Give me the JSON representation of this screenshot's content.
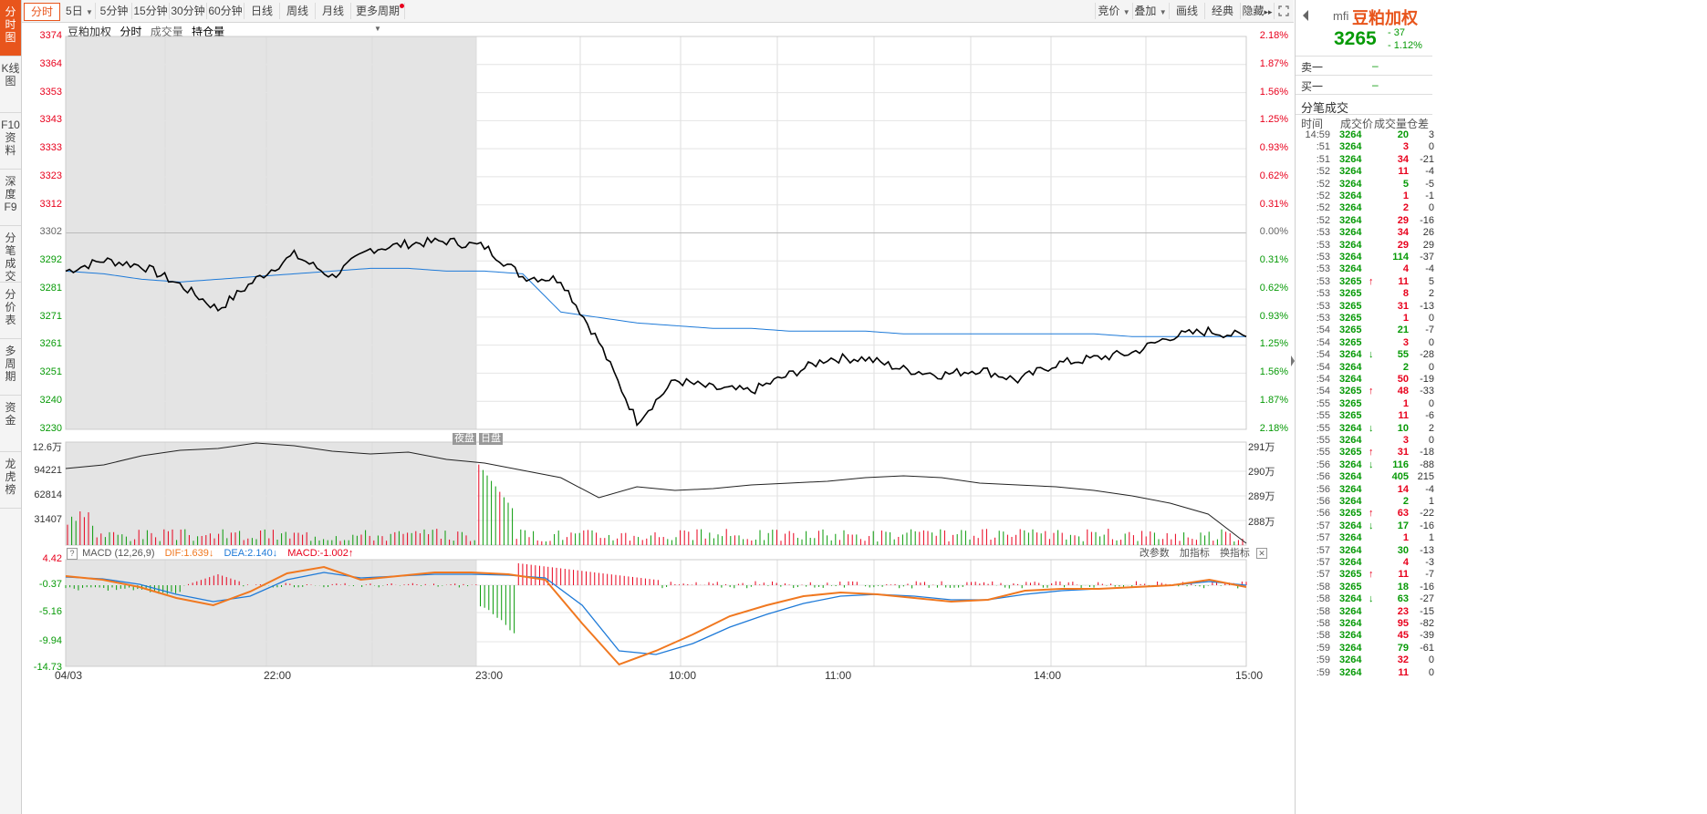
{
  "left_tabs": [
    "分时图",
    "K线图",
    "F10资料",
    "深度F9",
    "分笔成交",
    "分价表",
    "多周期",
    "资金",
    "龙虎榜"
  ],
  "toolbar": {
    "periods": [
      "分时",
      "5日",
      "5分钟",
      "15分钟",
      "30分钟",
      "60分钟",
      "日线",
      "周线",
      "月线",
      "更多周期"
    ],
    "right": [
      "竞价",
      "叠加",
      "画线",
      "经典",
      "隐藏"
    ]
  },
  "legend": {
    "name": "豆粕加权",
    "mode": "分时",
    "vol": "成交量",
    "oi": "持仓量"
  },
  "price_axis": {
    "left": [
      "3374",
      "3364",
      "3353",
      "3343",
      "3333",
      "3323",
      "3312",
      "3302",
      "3292",
      "3281",
      "3271",
      "3261",
      "3251",
      "3240",
      "3230"
    ],
    "right": [
      "2.18%",
      "1.87%",
      "1.56%",
      "1.25%",
      "0.93%",
      "0.62%",
      "0.31%",
      "0.00%",
      "0.31%",
      "0.62%",
      "0.93%",
      "1.25%",
      "1.56%",
      "1.87%",
      "2.18%"
    ]
  },
  "session_tags": {
    "night": "夜盘",
    "day": "日盘"
  },
  "volume_axis": {
    "left": [
      "12.6万",
      "94221",
      "62814",
      "31407"
    ],
    "right": [
      "291万",
      "290万",
      "289万",
      "288万"
    ]
  },
  "macd": {
    "title": "MACD (12,26,9)",
    "dif": "DIF:1.639↓",
    "dea": "DEA:2.140↓",
    "macd": "MACD:-1.002↑",
    "help": "?",
    "links": [
      "改参数",
      "加指标",
      "换指标"
    ],
    "axis": [
      "4.42",
      "-0.37",
      "-5.16",
      "-9.94",
      "-14.73"
    ]
  },
  "time_axis": [
    "04/03",
    "22:00",
    "23:00",
    "10:00",
    "11:00",
    "14:00",
    "15:00"
  ],
  "colors": {
    "up": "#e8001c",
    "down": "#079a07",
    "accent": "#e8551c",
    "avg": "#1e7ad8",
    "dif": "#f07820",
    "dea": "#1e7ad8"
  },
  "quote": {
    "code": "mfi",
    "name": "豆粕加权",
    "price": "3265",
    "change": "- 37",
    "pct": "- 1.12%"
  },
  "orderbook": {
    "sell_label": "卖一",
    "sell_val": "–",
    "buy_label": "买一",
    "buy_val": "–"
  },
  "ticks_title": "分笔成交",
  "ticks_header": [
    "时间",
    "成交价",
    "成交量",
    "仓差"
  ],
  "ticks": [
    {
      "t": "14:59",
      "p": "3264",
      "a": "",
      "v": "20",
      "d": "3",
      "c": "g"
    },
    {
      "t": ":51",
      "p": "3264",
      "a": "",
      "v": "3",
      "d": "0",
      "c": "r"
    },
    {
      "t": ":51",
      "p": "3264",
      "a": "",
      "v": "34",
      "d": "-21",
      "c": "r"
    },
    {
      "t": ":52",
      "p": "3264",
      "a": "",
      "v": "11",
      "d": "-4",
      "c": "r"
    },
    {
      "t": ":52",
      "p": "3264",
      "a": "",
      "v": "5",
      "d": "-5",
      "c": "g"
    },
    {
      "t": ":52",
      "p": "3264",
      "a": "",
      "v": "1",
      "d": "-1",
      "c": "r"
    },
    {
      "t": ":52",
      "p": "3264",
      "a": "",
      "v": "2",
      "d": "0",
      "c": "r"
    },
    {
      "t": ":52",
      "p": "3264",
      "a": "",
      "v": "29",
      "d": "-16",
      "c": "r"
    },
    {
      "t": ":53",
      "p": "3264",
      "a": "",
      "v": "34",
      "d": "26",
      "c": "r"
    },
    {
      "t": ":53",
      "p": "3264",
      "a": "",
      "v": "29",
      "d": "29",
      "c": "r"
    },
    {
      "t": ":53",
      "p": "3264",
      "a": "",
      "v": "114",
      "d": "-37",
      "c": "g"
    },
    {
      "t": ":53",
      "p": "3264",
      "a": "",
      "v": "4",
      "d": "-4",
      "c": "r"
    },
    {
      "t": ":53",
      "p": "3265",
      "a": "↑",
      "v": "11",
      "d": "5",
      "c": "r"
    },
    {
      "t": ":53",
      "p": "3265",
      "a": "",
      "v": "8",
      "d": "2",
      "c": "r"
    },
    {
      "t": ":53",
      "p": "3265",
      "a": "",
      "v": "31",
      "d": "-13",
      "c": "r"
    },
    {
      "t": ":53",
      "p": "3265",
      "a": "",
      "v": "1",
      "d": "0",
      "c": "r"
    },
    {
      "t": ":54",
      "p": "3265",
      "a": "",
      "v": "21",
      "d": "-7",
      "c": "g"
    },
    {
      "t": ":54",
      "p": "3265",
      "a": "",
      "v": "3",
      "d": "0",
      "c": "r"
    },
    {
      "t": ":54",
      "p": "3264",
      "a": "↓",
      "v": "55",
      "d": "-28",
      "c": "g"
    },
    {
      "t": ":54",
      "p": "3264",
      "a": "",
      "v": "2",
      "d": "0",
      "c": "g"
    },
    {
      "t": ":54",
      "p": "3264",
      "a": "",
      "v": "50",
      "d": "-19",
      "c": "r"
    },
    {
      "t": ":54",
      "p": "3265",
      "a": "↑",
      "v": "48",
      "d": "-33",
      "c": "r"
    },
    {
      "t": ":55",
      "p": "3265",
      "a": "",
      "v": "1",
      "d": "0",
      "c": "r"
    },
    {
      "t": ":55",
      "p": "3265",
      "a": "",
      "v": "11",
      "d": "-6",
      "c": "r"
    },
    {
      "t": ":55",
      "p": "3264",
      "a": "↓",
      "v": "10",
      "d": "2",
      "c": "g"
    },
    {
      "t": ":55",
      "p": "3264",
      "a": "",
      "v": "3",
      "d": "0",
      "c": "r"
    },
    {
      "t": ":55",
      "p": "3265",
      "a": "↑",
      "v": "31",
      "d": "-18",
      "c": "r"
    },
    {
      "t": ":56",
      "p": "3264",
      "a": "↓",
      "v": "116",
      "d": "-88",
      "c": "g"
    },
    {
      "t": ":56",
      "p": "3264",
      "a": "",
      "v": "405",
      "d": "215",
      "c": "g"
    },
    {
      "t": ":56",
      "p": "3264",
      "a": "",
      "v": "14",
      "d": "-4",
      "c": "r"
    },
    {
      "t": ":56",
      "p": "3264",
      "a": "",
      "v": "2",
      "d": "1",
      "c": "g"
    },
    {
      "t": ":56",
      "p": "3265",
      "a": "↑",
      "v": "63",
      "d": "-22",
      "c": "r"
    },
    {
      "t": ":57",
      "p": "3264",
      "a": "↓",
      "v": "17",
      "d": "-16",
      "c": "g"
    },
    {
      "t": ":57",
      "p": "3264",
      "a": "",
      "v": "1",
      "d": "1",
      "c": "r"
    },
    {
      "t": ":57",
      "p": "3264",
      "a": "",
      "v": "30",
      "d": "-13",
      "c": "g"
    },
    {
      "t": ":57",
      "p": "3264",
      "a": "",
      "v": "4",
      "d": "-3",
      "c": "r"
    },
    {
      "t": ":57",
      "p": "3265",
      "a": "↑",
      "v": "11",
      "d": "-7",
      "c": "r"
    },
    {
      "t": ":58",
      "p": "3265",
      "a": "",
      "v": "18",
      "d": "-16",
      "c": "g"
    },
    {
      "t": ":58",
      "p": "3264",
      "a": "↓",
      "v": "63",
      "d": "-27",
      "c": "g"
    },
    {
      "t": ":58",
      "p": "3264",
      "a": "",
      "v": "23",
      "d": "-15",
      "c": "r"
    },
    {
      "t": ":58",
      "p": "3264",
      "a": "",
      "v": "95",
      "d": "-82",
      "c": "r"
    },
    {
      "t": ":58",
      "p": "3264",
      "a": "",
      "v": "45",
      "d": "-39",
      "c": "r"
    },
    {
      "t": ":59",
      "p": "3264",
      "a": "",
      "v": "79",
      "d": "-61",
      "c": "g"
    },
    {
      "t": ":59",
      "p": "3264",
      "a": "",
      "v": "32",
      "d": "0",
      "c": "r"
    },
    {
      "t": ":59",
      "p": "3264",
      "a": "",
      "v": "11",
      "d": "0",
      "c": "r"
    }
  ],
  "chart_data": {
    "type": "line",
    "title": "豆粕加权 分时",
    "prev_close": 3302,
    "ylim": [
      3230,
      3374
    ],
    "x_ticks": [
      "04/03",
      "22:00",
      "23:00",
      "10:00",
      "11:00",
      "14:00",
      "15:00"
    ],
    "series": [
      {
        "name": "价格",
        "values": [
          3288,
          3292,
          3290,
          3283,
          3274,
          3285,
          3294,
          3286,
          3296,
          3298,
          3299,
          3297,
          3286,
          3285,
          3262,
          3233,
          3248,
          3245,
          3244,
          3250,
          3256,
          3256,
          3252,
          3250,
          3252,
          3248,
          3254,
          3256,
          3258,
          3264,
          3266,
          3264
        ]
      },
      {
        "name": "均价",
        "values": [
          3288,
          3287,
          3285,
          3284,
          3285,
          3286,
          3287,
          3288,
          3289,
          3289,
          3288,
          3288,
          3287,
          3273,
          3271,
          3269,
          3268,
          3267,
          3267,
          3266,
          3266,
          3266,
          3265,
          3265,
          3265,
          3265,
          3265,
          3265,
          3264,
          3264,
          3264,
          3264
        ]
      }
    ]
  }
}
